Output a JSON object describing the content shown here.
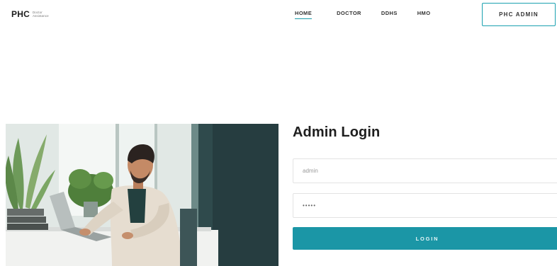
{
  "brand": {
    "mark": "PHC",
    "tagline_line1": "Doctor",
    "tagline_line2": "Assistance"
  },
  "nav": {
    "items": [
      {
        "label": "HOME",
        "active": true
      },
      {
        "label": "DOCTOR",
        "active": false
      },
      {
        "label": "DDHS",
        "active": false
      },
      {
        "label": "HMO",
        "active": false
      }
    ],
    "admin_button": "PHC ADMIN"
  },
  "login": {
    "title": "Admin Login",
    "username_value": "admin",
    "password_value": "•••••",
    "submit_label": "LOGIN"
  },
  "colors": {
    "accent": "#1b96a6",
    "title": "#1e1e1e"
  },
  "hero": {
    "icon": "office-man-at-laptop-photo"
  }
}
